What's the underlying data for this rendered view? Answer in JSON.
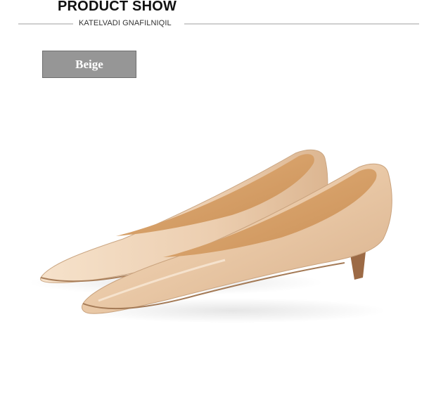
{
  "header": {
    "title": "PRODUCT SHOW",
    "subtitle": "KATELVADI GNAFILNIQIL"
  },
  "color_tag": {
    "label": "Beige"
  },
  "product": {
    "icon": "beige-pointed-toe-kitten-heel-pumps"
  },
  "colors": {
    "tag_background": "#969696",
    "shoe_leather": "#e8c9a9",
    "shoe_lining": "#d9a673",
    "heel": "#9c6a45"
  }
}
